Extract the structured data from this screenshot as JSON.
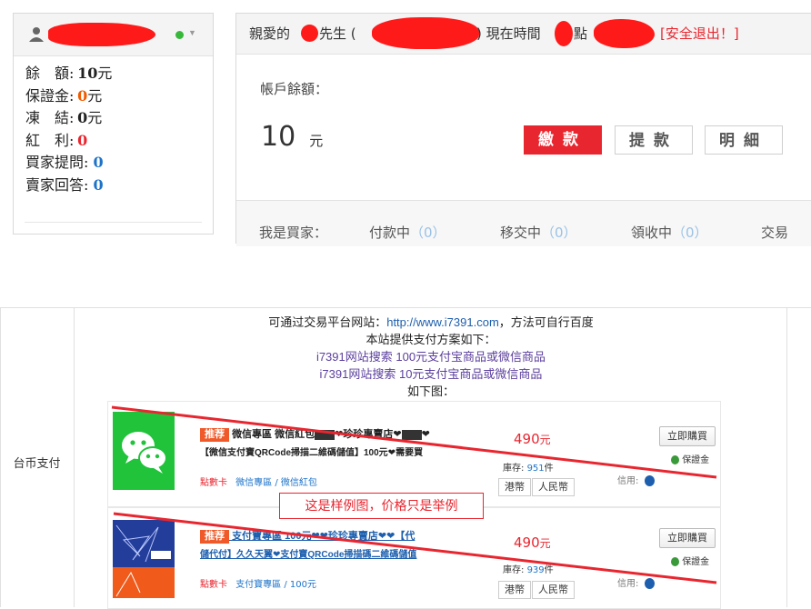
{
  "user_panel": {
    "stats": [
      {
        "label": "餘　額:",
        "value": "10",
        "unit": "元"
      },
      {
        "label": "保證金:",
        "value": "0",
        "unit": "元"
      },
      {
        "label": "凍　結:",
        "value": "0",
        "unit": "元"
      },
      {
        "label": "紅　利:",
        "value": "0",
        "unit": ""
      },
      {
        "label": "買家提問:",
        "value": "0",
        "unit": ""
      },
      {
        "label": "賣家回答:",
        "value": "0",
        "unit": ""
      }
    ],
    "status_icon": "online-check-icon"
  },
  "account_panel": {
    "greeting_prefix": "親愛的",
    "greeting_suffix": "先生 (",
    "time_prefix": ") 現在時間",
    "time_hour": "點",
    "logout": "[安全退出！]",
    "balance_label": "帳戶餘額：",
    "balance_value": "10",
    "balance_unit": "元",
    "btn_pay": "繳款",
    "btn_withdraw": "提款",
    "btn_detail": "明細",
    "buyer_label": "我是買家：",
    "buyer_tabs": [
      {
        "label": "付款中",
        "count": "（0）"
      },
      {
        "label": "移交中",
        "count": "（0）"
      },
      {
        "label": "領收中",
        "count": "（0）"
      },
      {
        "label": "交易",
        "count": ""
      }
    ]
  },
  "lower": {
    "row_label": "台币支付",
    "line1_prefix": "可通过交易平台网站：",
    "line1_url": "http://www.i7391.com",
    "line1_suffix": "，方法可自行百度",
    "line2": "本站提供支付方案如下：",
    "line3": "i7391网站搜索 100元支付宝商品或微信商品",
    "line4": "i7391网站搜索 10元支付宝商品或微信商品",
    "line5": "如下图：",
    "sample_note": "这是样例图，价格只是举例",
    "products": [
      {
        "tag": "推荐",
        "title_a": "微信專區 微信紅包",
        "title_b": "❤珍珍專賣店❤",
        "title_c": "❤",
        "title_line2": "【微信支付寶QRCode掃描二維碼儲值】100元❤需要買",
        "category_prefix": "點數卡",
        "category": "微信專區 / 微信紅包",
        "price": "490",
        "price_unit": "元",
        "stock_label": "庫存:",
        "stock": "951",
        "stock_unit": "件",
        "currency_1": "港幣",
        "currency_2": "人民幣",
        "buy": "立即購買",
        "guarantee": "保證金",
        "credit": "信用:",
        "accent": "#20c33a"
      },
      {
        "tag": "推荐",
        "title_a": "支付寶專區 100元",
        "title_b": "❤❤珍珍專賣店❤❤",
        "title_c": "【代",
        "title_line2": "儲代付】久久天翼❤支付寶QRCode掃描碼二維碼儲值",
        "category_prefix": "點數卡",
        "category": "支付寶專區 / 100元",
        "price": "490",
        "price_unit": "元",
        "stock_label": "庫存:",
        "stock": "939",
        "stock_unit": "件",
        "currency_1": "港幣",
        "currency_2": "人民幣",
        "buy": "立即購買",
        "guarantee": "保證金",
        "credit": "信用:",
        "accent": "#f05a1a"
      }
    ]
  }
}
